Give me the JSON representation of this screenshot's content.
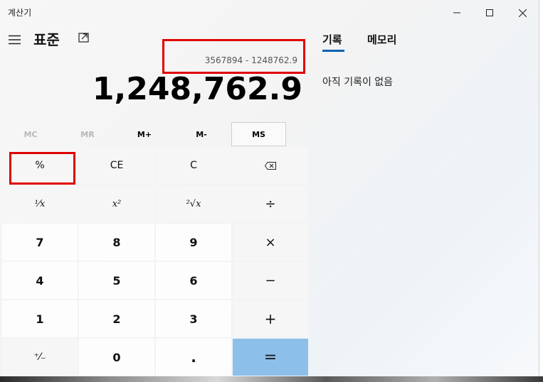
{
  "window": {
    "title": "계산기",
    "minimize_icon": "minimize-icon",
    "maximize_icon": "maximize-icon",
    "close_icon": "close-icon"
  },
  "header": {
    "mode_title": "표준",
    "menu_icon": "hamburger-menu-icon",
    "keep_on_top_icon": "keep-on-top-icon"
  },
  "display": {
    "expression": "3567894 - 1248762.9",
    "result": "1,248,762.9"
  },
  "memory": {
    "mc": "MC",
    "mr": "MR",
    "mplus": "M+",
    "mminus": "M-",
    "ms": "MS"
  },
  "keys": {
    "percent": "%",
    "ce": "CE",
    "c": "C",
    "backspace_icon": "backspace-icon",
    "reciprocal": "¹⁄x",
    "square": "x²",
    "sqrt": "²√x",
    "divide": "÷",
    "seven": "7",
    "eight": "8",
    "nine": "9",
    "multiply": "×",
    "four": "4",
    "five": "5",
    "six": "6",
    "minus": "−",
    "one": "1",
    "two": "2",
    "three": "3",
    "plus": "+",
    "negate": "⁺⁄₋",
    "zero": "0",
    "decimal": ".",
    "equals": "="
  },
  "side_panel": {
    "tab_history": "기록",
    "tab_memory": "메모리",
    "empty_message": "아직 기록이 없음"
  },
  "colors": {
    "highlight_box": "#e00000",
    "equals_key": "#8cc0ea",
    "tab_accent": "#0063b1"
  }
}
